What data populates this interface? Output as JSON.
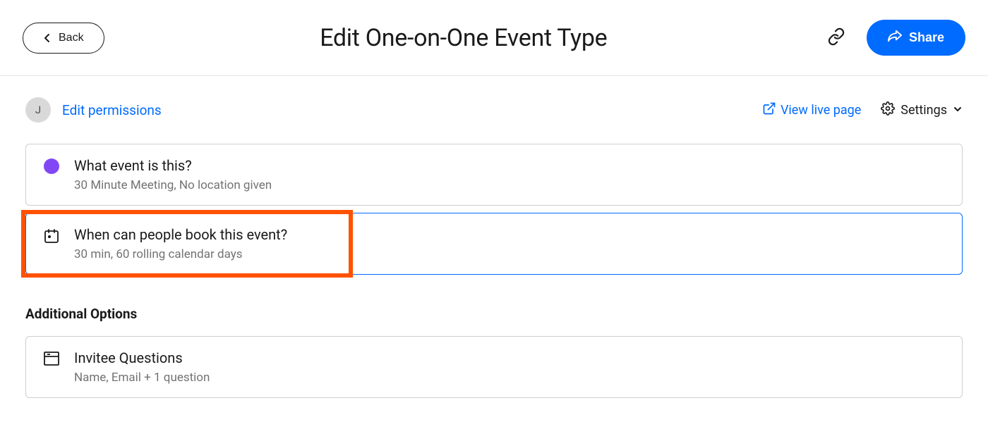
{
  "header": {
    "back_label": "Back",
    "title": "Edit One-on-One Event Type",
    "share_label": "Share"
  },
  "permissions": {
    "avatar_initial": "J",
    "edit_link": "Edit permissions",
    "view_live": "View live page",
    "settings": "Settings"
  },
  "sections": [
    {
      "title": "What event is this?",
      "subtitle": "30 Minute Meeting, No location given"
    },
    {
      "title": "When can people book this event?",
      "subtitle": "30 min, 60 rolling calendar days"
    }
  ],
  "additional_heading": "Additional Options",
  "additional": [
    {
      "title": "Invitee Questions",
      "subtitle": "Name, Email + 1 question"
    }
  ],
  "colors": {
    "primary": "#006bff",
    "highlight": "#ff5200",
    "event_color": "#8247f5"
  }
}
